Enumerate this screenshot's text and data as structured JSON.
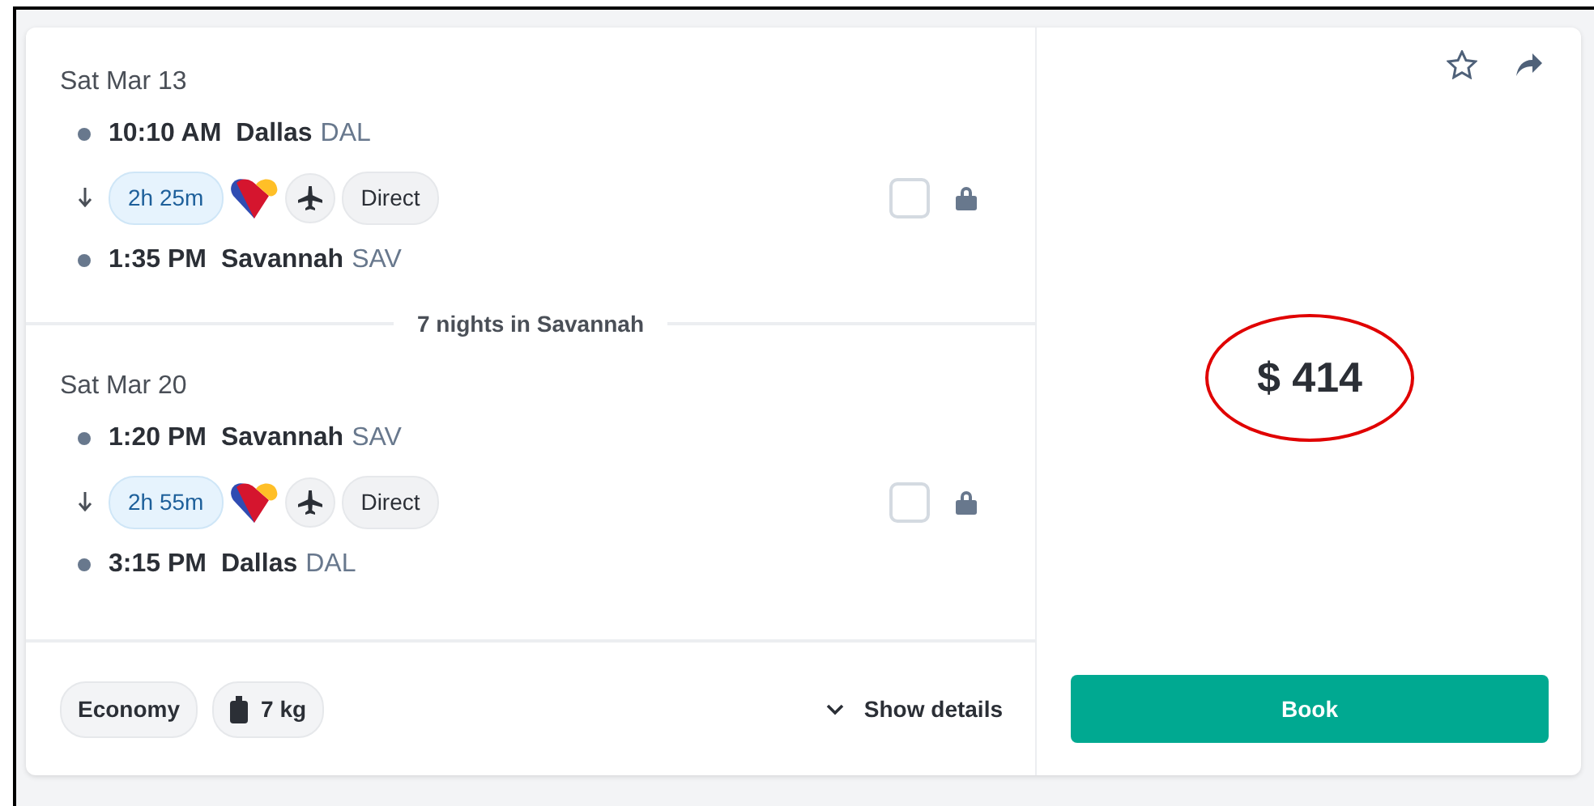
{
  "legs": [
    {
      "date": "Sat Mar 13",
      "departure": {
        "time": "10:10 AM",
        "city": "Dallas",
        "code": "DAL"
      },
      "duration": "2h 25m",
      "stops": "Direct",
      "arrival": {
        "time": "1:35 PM",
        "city": "Savannah",
        "code": "SAV"
      },
      "checked": false
    },
    {
      "date": "Sat Mar 20",
      "departure": {
        "time": "1:20 PM",
        "city": "Savannah",
        "code": "SAV"
      },
      "duration": "2h 55m",
      "stops": "Direct",
      "arrival": {
        "time": "3:15 PM",
        "city": "Dallas",
        "code": "DAL"
      },
      "checked": false
    }
  ],
  "stay": "7 nights in Savannah",
  "cabin": "Economy",
  "baggage": "7 kg",
  "details_link": "Show details",
  "price": {
    "amount": "$ 414",
    "highlighted": true
  },
  "book_button": "Book"
}
